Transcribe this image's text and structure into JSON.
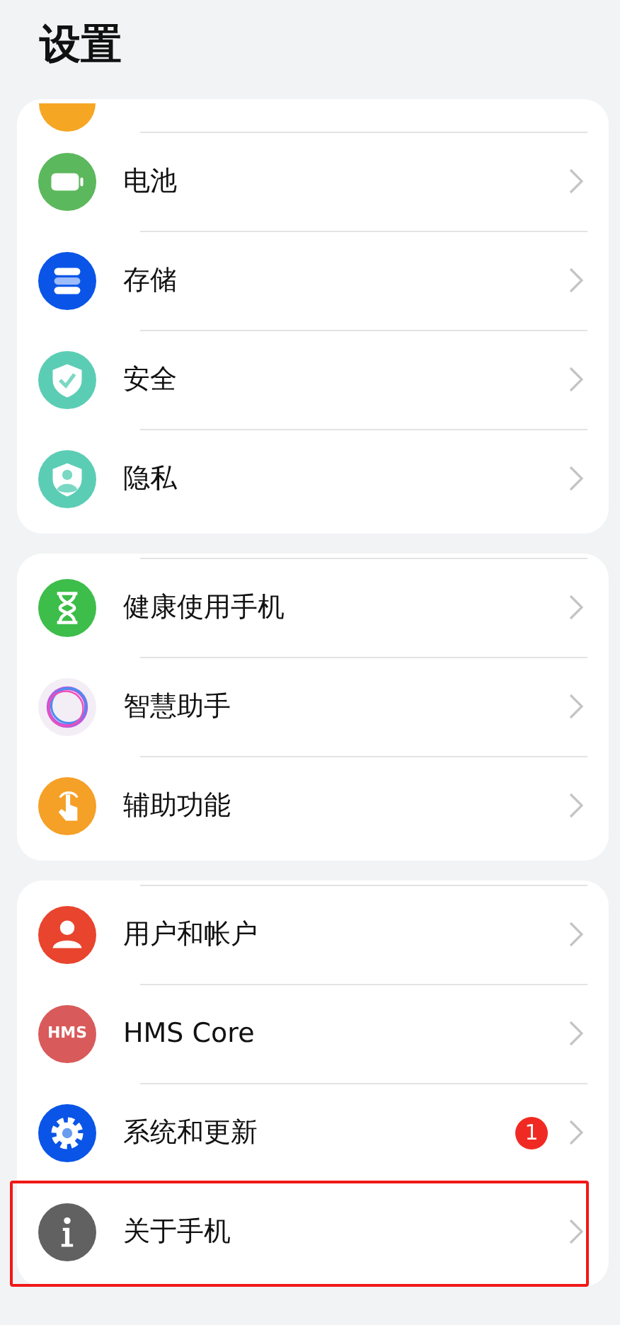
{
  "title": "设置",
  "groups": [
    {
      "items": [
        {
          "clipped": true
        },
        {
          "label": "电池"
        },
        {
          "label": "存储"
        },
        {
          "label": "安全"
        },
        {
          "label": "隐私"
        }
      ]
    },
    {
      "items": [
        {
          "label": "健康使用手机"
        },
        {
          "label": "智慧助手"
        },
        {
          "label": "辅助功能"
        }
      ]
    },
    {
      "items": [
        {
          "label": "用户和帐户"
        },
        {
          "icon_text": "HMS",
          "label": "HMS Core"
        },
        {
          "label": "系统和更新",
          "badge": "1"
        },
        {
          "label": "关于手机",
          "highlighted": true
        }
      ]
    }
  ]
}
